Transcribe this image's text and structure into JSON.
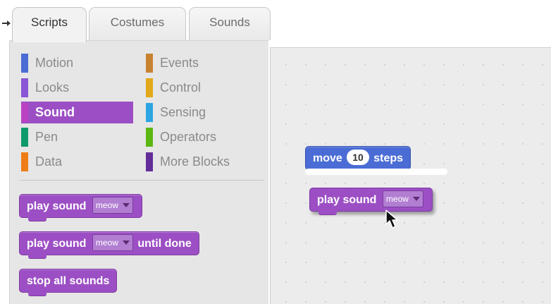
{
  "tabs": [
    {
      "label": "Scripts",
      "active": true
    },
    {
      "label": "Costumes",
      "active": false
    },
    {
      "label": "Sounds",
      "active": false
    }
  ],
  "categories": [
    {
      "label": "Motion",
      "color": "#4a6cd4",
      "selected": false
    },
    {
      "label": "Looks",
      "color": "#8a55d7",
      "selected": false
    },
    {
      "label": "Sound",
      "color": "#bb42c3",
      "selected": true
    },
    {
      "label": "Pen",
      "color": "#0e9a6c",
      "selected": false
    },
    {
      "label": "Data",
      "color": "#ee7d16",
      "selected": false
    },
    {
      "label": "Events",
      "color": "#c88330",
      "selected": false
    },
    {
      "label": "Control",
      "color": "#e1a91a",
      "selected": false
    },
    {
      "label": "Sensing",
      "color": "#2ca5e2",
      "selected": false
    },
    {
      "label": "Operators",
      "color": "#5cb712",
      "selected": false
    },
    {
      "label": "More Blocks",
      "color": "#632d99",
      "selected": false
    }
  ],
  "palette_blocks": {
    "play_sound": {
      "label": "play sound",
      "menu": "meow"
    },
    "play_sound_until": {
      "label": "play sound",
      "menu": "meow",
      "suffix": "until done"
    },
    "stop_all": {
      "label": "stop all sounds"
    }
  },
  "script": {
    "move": {
      "label_a": "move",
      "value": "10",
      "label_b": "steps"
    },
    "drag": {
      "label": "play sound",
      "menu": "meow"
    }
  },
  "colors": {
    "sound": "#9c4fc4",
    "motion": "#4a6cd4",
    "palette_bg": "#e6e6e6",
    "script_bg": "#ececec"
  },
  "icons": [
    "dropdown-caret-icon",
    "mouse-pointer-icon"
  ]
}
